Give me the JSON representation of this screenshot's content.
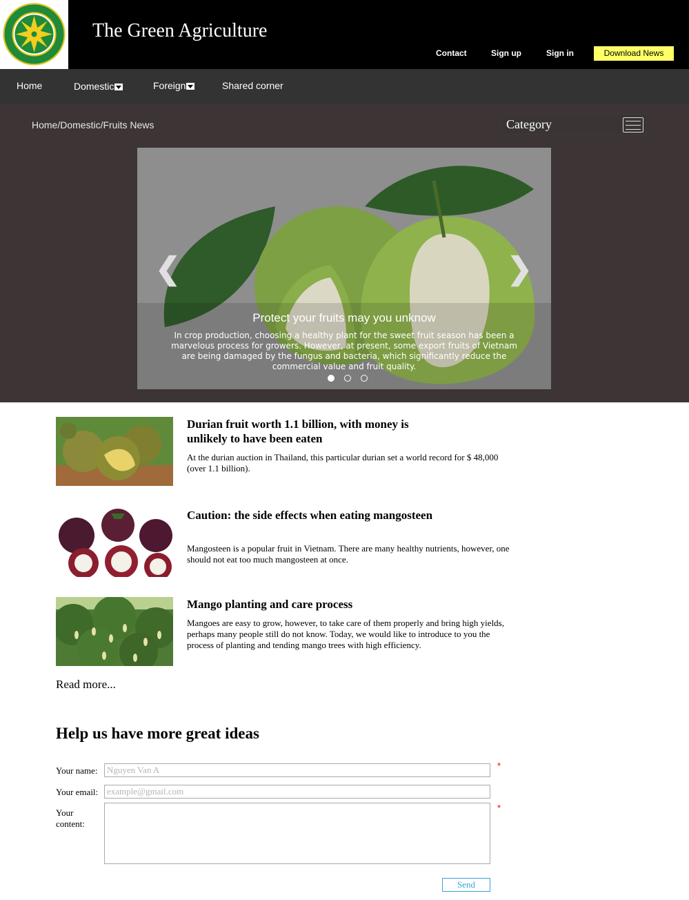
{
  "header": {
    "logo_text": "HỌC VIỆN NÔNG NGHIỆP VIỆT NAM 1956",
    "site_title": "The Green Agriculture",
    "links": {
      "contact": "Contact",
      "sign_up": "Sign up",
      "sign_in": "Sign in"
    },
    "download_label": "Download News",
    "colors": {
      "bar": "#000000",
      "download_bg": "#ffff66"
    }
  },
  "nav": {
    "home": "Home",
    "domestic": "Domestic",
    "foreign": "Foreign",
    "shared": "Shared corner"
  },
  "hero": {
    "breadcrumb": "Home/Domestic/Fruits News",
    "category_label": "Category",
    "slide": {
      "title": "Protect your fruits may you unknow",
      "text": "In crop production, choosing a healthy plant for the sweet fruit season has been a marvelous process for growers. However, at present, some export fruits of Vietnam are being damaged by the fungus and bacteria, which significantly reduce the commercial value and fruit quality."
    },
    "slide_count": 3,
    "active_slide": 1
  },
  "articles": [
    {
      "title": "Durian fruit worth 1.1 billion, with money is unlikely to have been eaten",
      "summary": "At the durian auction in Thailand, this particular durian set a world record for $ 48,000 (over 1.1 billion)."
    },
    {
      "title": "Caution: the side effects when eating mangosteen",
      "summary": "Mangosteen is a popular fruit in Vietnam. There are many healthy nutrients, however, one should not eat too much mangosteen at once."
    },
    {
      "title": "Mango planting and care process",
      "summary": "Mangoes are easy to grow, however, to take care of them properly and bring high yields, perhaps many people still do not know. Today, we would like to introduce to you the process of planting and tending mango trees with high efficiency."
    }
  ],
  "read_more": "Read more...",
  "form": {
    "title": "Help us have more great ideas",
    "name_label": "Your name:",
    "name_placeholder": "Nguyen Van A",
    "email_label": "Your email:",
    "email_placeholder": "example@gmail.com",
    "content_label": "Your content:",
    "required_mark": "*",
    "send_label": "Send"
  }
}
